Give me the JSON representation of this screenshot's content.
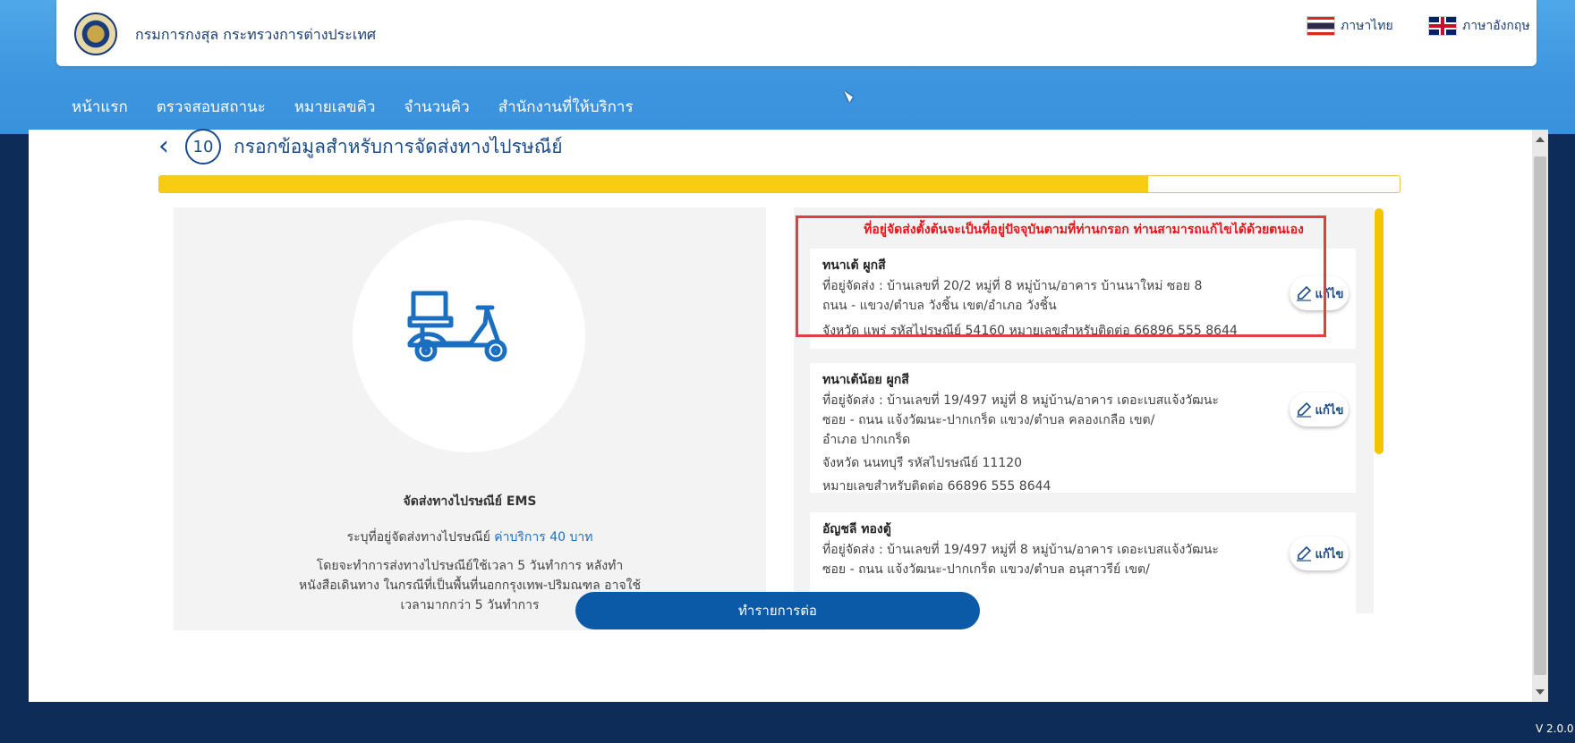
{
  "header": {
    "org_name": "กรมการกงสุล กระทรวงการต่างประเทศ",
    "lang_thai": "ภาษาไทย",
    "lang_separator": "|",
    "lang_english": "ภาษาอังกฤษ"
  },
  "nav": {
    "items": [
      "หน้าแรก",
      "ตรวจสอบสถานะ",
      "หมายเลขคิว",
      "จำนวนคิว",
      "สำนักงานที่ให้บริการ"
    ]
  },
  "step": {
    "number": "10",
    "title": "กรอกข้อมูลสำหรับการจัดส่งทางไปรษณีย์",
    "progress_fraction": 0.797
  },
  "ems": {
    "title": "จัดส่งทางไปรษณีย์ EMS",
    "specify_label": "ระบุที่อยู่จัดส่งทางไปรษณีย์",
    "price": "ค่าบริการ 40 บาท",
    "description": "โดยจะทำการส่งทางไปรษณีย์ใช้เวลา 5 วันทำการ หลังทำหนังสือเดินทาง ในกรณีที่เป็นพื้นที่นอกกรุงเทพ-ปริมณฑล อาจใช้เวลามากกว่า 5 วันทำการ"
  },
  "address_panel": {
    "notice": "ที่อยู่จัดส่งตั้งต้นจะเป็นที่อยู่ปัจจุบันตามที่ท่านกรอก ท่านสามารถแก้ไขได้ด้วยตนเอง",
    "edit_label": "แก้ไข",
    "addresses": [
      {
        "name": "ทนาเต้ ผูกสี",
        "line1": "ที่อยู่จัดส่ง : บ้านเลขที่ 20/2 หมู่ที่ 8 หมู่บ้าน/อาคาร บ้านนาใหม่ ซอย 8",
        "line2": "ถนน - แขวง/ตำบล วังชิ้น เขต/อำเภอ วังชิ้น",
        "line3": "จังหวัด แพร่ รหัสไปรษณีย์ 54160 หมายเลขสำหรับติดต่อ 66896 555 8644"
      },
      {
        "name": "ทนาเต้น้อย ผูกสี",
        "line1": "ที่อยู่จัดส่ง : บ้านเลขที่ 19/497 หมู่ที่ 8 หมู่บ้าน/อาคาร เดอะเบสแจ้งวัฒนะ",
        "line2": "ซอย - ถนน แจ้งวัฒนะ-ปากเกร็ด แขวง/ตำบล คลองเกลือ เขต/",
        "line3": "อำเภอ ปากเกร็ด",
        "line4": "จังหวัด นนทบุรี รหัสไปรษณีย์ 11120",
        "line5": "หมายเลขสำหรับติดต่อ 66896 555 8644"
      },
      {
        "name": "อัญชลี ทองตู้",
        "line1": "ที่อยู่จัดส่ง : บ้านเลขที่ 19/497 หมู่ที่ 8 หมู่บ้าน/อาคาร เดอะเบสแจ้งวัฒนะ",
        "line2": "ซอย - ถนน แจ้งวัฒนะ-ปากเกร็ด แขวง/ตำบล อนุสาวรีย์ เขต/"
      }
    ]
  },
  "actions": {
    "continue_label": "ทำรายการต่อ"
  },
  "footer": {
    "version": "V 2.0.0"
  },
  "colors": {
    "primary": "#0b5aa7",
    "accent_yellow": "#f7cc12",
    "notice_red": "#e5161b",
    "nav_bg": "#4ea8e8"
  }
}
